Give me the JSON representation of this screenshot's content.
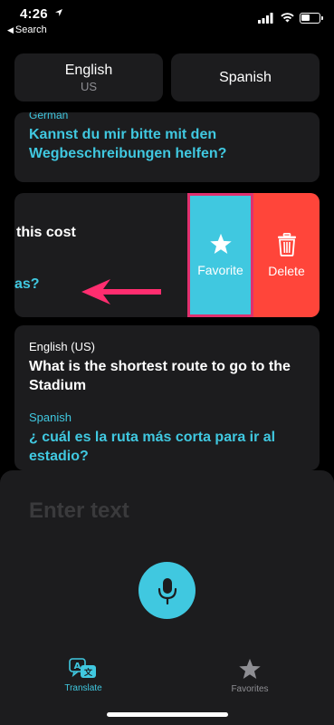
{
  "status_bar": {
    "time": "4:26",
    "back_label": "Search"
  },
  "languages": {
    "source": {
      "name": "English",
      "region": "US"
    },
    "target": {
      "name": "Spanish"
    }
  },
  "conversation": {
    "card1": {
      "language": "German",
      "phrase": "Kannst du mir bitte mit den Wegbeschreibungen helfen?"
    },
    "card2": {
      "source_fragment": "this cost",
      "target_fragment": "as?"
    },
    "card3": {
      "source_language": "English (US)",
      "source_phrase": "What is the shortest route to go to the Stadium",
      "target_language": "Spanish",
      "target_phrase": "¿ cuál es la ruta más corta para ir al estadio?"
    }
  },
  "swipe_actions": {
    "favorite_label": "Favorite",
    "delete_label": "Delete"
  },
  "input": {
    "placeholder": "Enter text"
  },
  "tabs": [
    {
      "label": "Translate",
      "icon": "translate-icon",
      "active": true
    },
    {
      "label": "Favorites",
      "icon": "star-icon",
      "active": false
    }
  ],
  "colors": {
    "accent": "#40c8e0",
    "delete": "#ff453a",
    "highlight": "#e0306e",
    "card": "#1c1c1e",
    "background": "#000000"
  }
}
